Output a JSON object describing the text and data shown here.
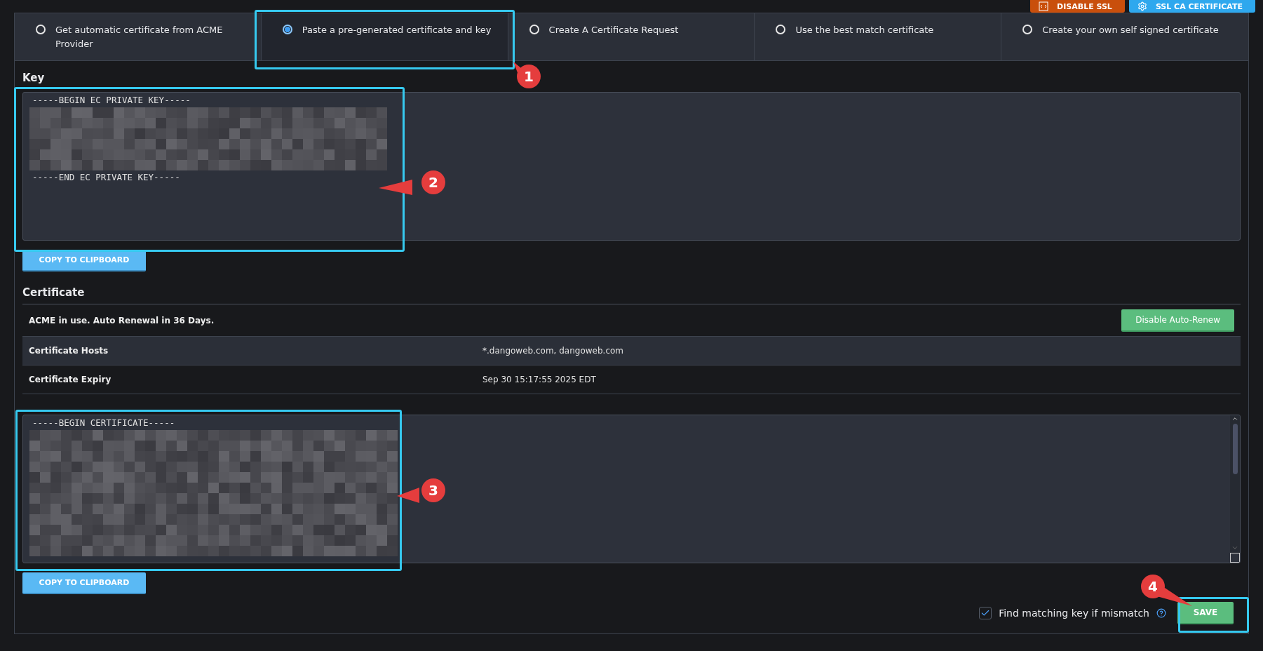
{
  "header_buttons": [
    {
      "kind": "danger",
      "label": "DISABLE SSL"
    },
    {
      "kind": "primary",
      "label": "SSL CA CERTIFICATE"
    }
  ],
  "tabs": [
    {
      "label": "Get automatic certificate from ACME Provider",
      "selected": false
    },
    {
      "label": "Paste a pre-generated certificate and key",
      "selected": true
    },
    {
      "label": "Create A Certificate Request",
      "selected": false
    },
    {
      "label": "Use the best match certificate",
      "selected": false
    },
    {
      "label": "Create your own self signed certificate",
      "selected": false
    }
  ],
  "key": {
    "title": "Key",
    "first_line": "-----BEGIN EC PRIVATE KEY-----",
    "last_line": "-----END EC PRIVATE KEY-----",
    "copy_button": "COPY TO CLIPBOARD"
  },
  "certificate": {
    "title": "Certificate",
    "status": "ACME in use. Auto Renewal in 36 Days.",
    "action_button": "Disable Auto-Renew",
    "rows": [
      {
        "label": "Certificate Hosts",
        "value": "*.dangoweb.com, dangoweb.com"
      },
      {
        "label": "Certificate Expiry",
        "value": "Sep 30 15:17:55 2025 EDT"
      }
    ],
    "first_line": "-----BEGIN CERTIFICATE-----",
    "copy_button": "COPY TO CLIPBOARD"
  },
  "footer": {
    "checkbox": {
      "label": "Find matching key if mismatch",
      "checked": true
    },
    "save_button": "SAVE"
  },
  "annotations": [
    {
      "label": "1"
    },
    {
      "label": "2"
    },
    {
      "label": "3"
    },
    {
      "label": "4"
    }
  ]
}
